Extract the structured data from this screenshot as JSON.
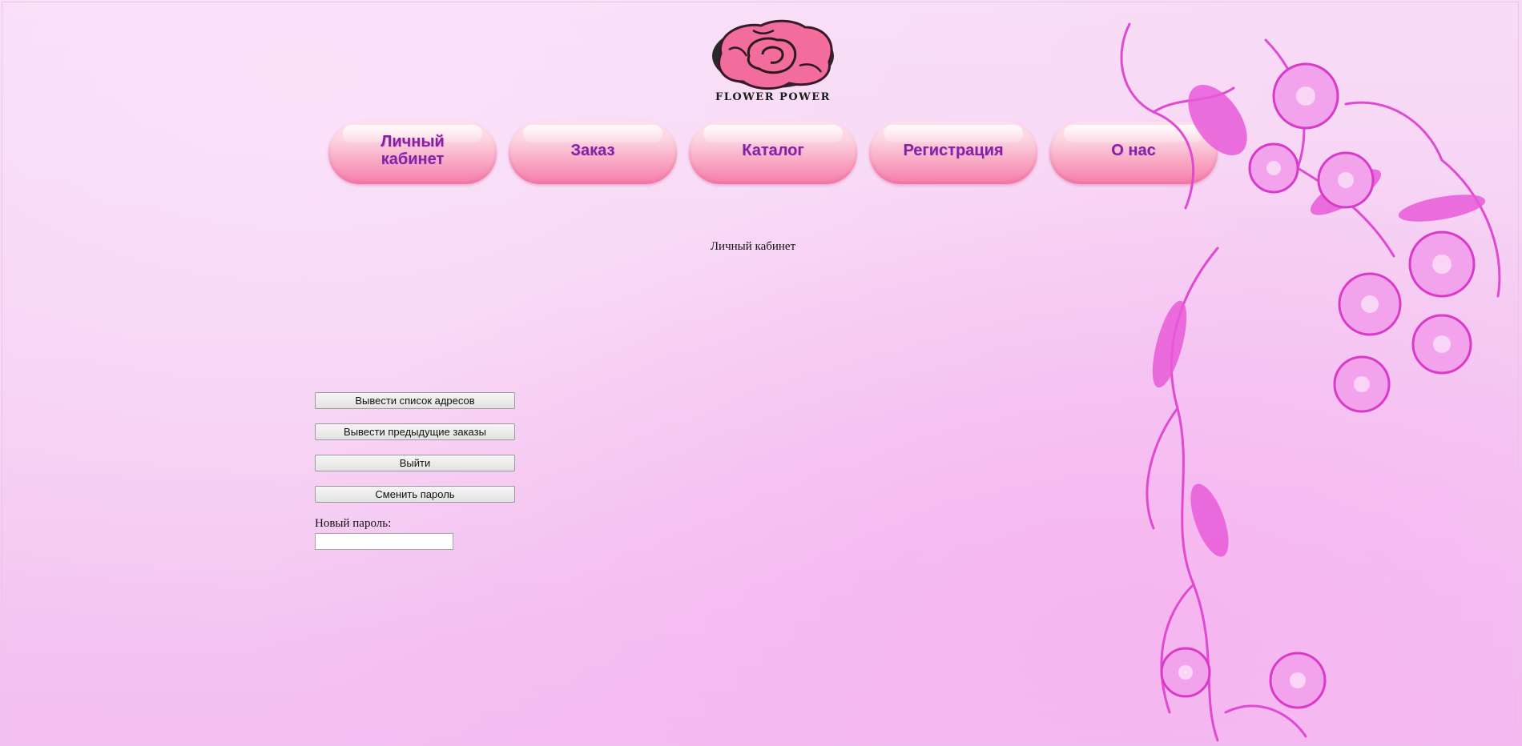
{
  "logo": {
    "text": "FLOWER POWER",
    "icon": "rose-icon"
  },
  "nav": {
    "items": [
      {
        "label": "Личный кабинет"
      },
      {
        "label": "Заказ"
      },
      {
        "label": "Каталог"
      },
      {
        "label": "Регистрация"
      },
      {
        "label": "О нас"
      }
    ]
  },
  "main": {
    "title": "Личный кабинет",
    "buttons": {
      "addresses": "Вывести список адресов",
      "orders": "Вывести предыдущие заказы",
      "logout": "Выйти",
      "change_password": "Сменить пароль"
    },
    "new_password": {
      "label": "Новый пароль:",
      "value": "",
      "placeholder": ""
    }
  },
  "colors": {
    "background": "#f5cdf3",
    "nav_text": "#8a1fa0",
    "nav_button": "#f68fb4",
    "rose": "#f0709e",
    "floral": "#e04ad0"
  }
}
